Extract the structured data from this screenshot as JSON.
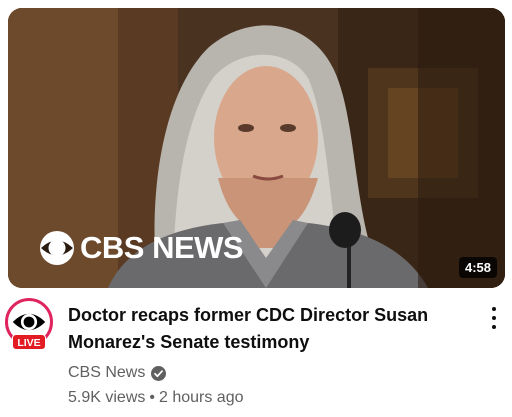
{
  "video": {
    "thumbnail_logo_text": "CBS NEWS",
    "duration": "4:58",
    "title": "Doctor recaps former CDC Director Susan Monarez's Senate testimony",
    "channel": "CBS News",
    "views": "5.9K views",
    "separator": "•",
    "age": "2 hours ago",
    "live_badge": "LIVE"
  },
  "icons": {
    "verified": "verified-check-icon",
    "menu": "more-vert-icon",
    "logo": "cbs-eye-icon"
  },
  "colors": {
    "live_red": "#e31b23",
    "avatar_ring": "#e0245e",
    "title": "#0f0f0f",
    "meta": "#606060"
  }
}
